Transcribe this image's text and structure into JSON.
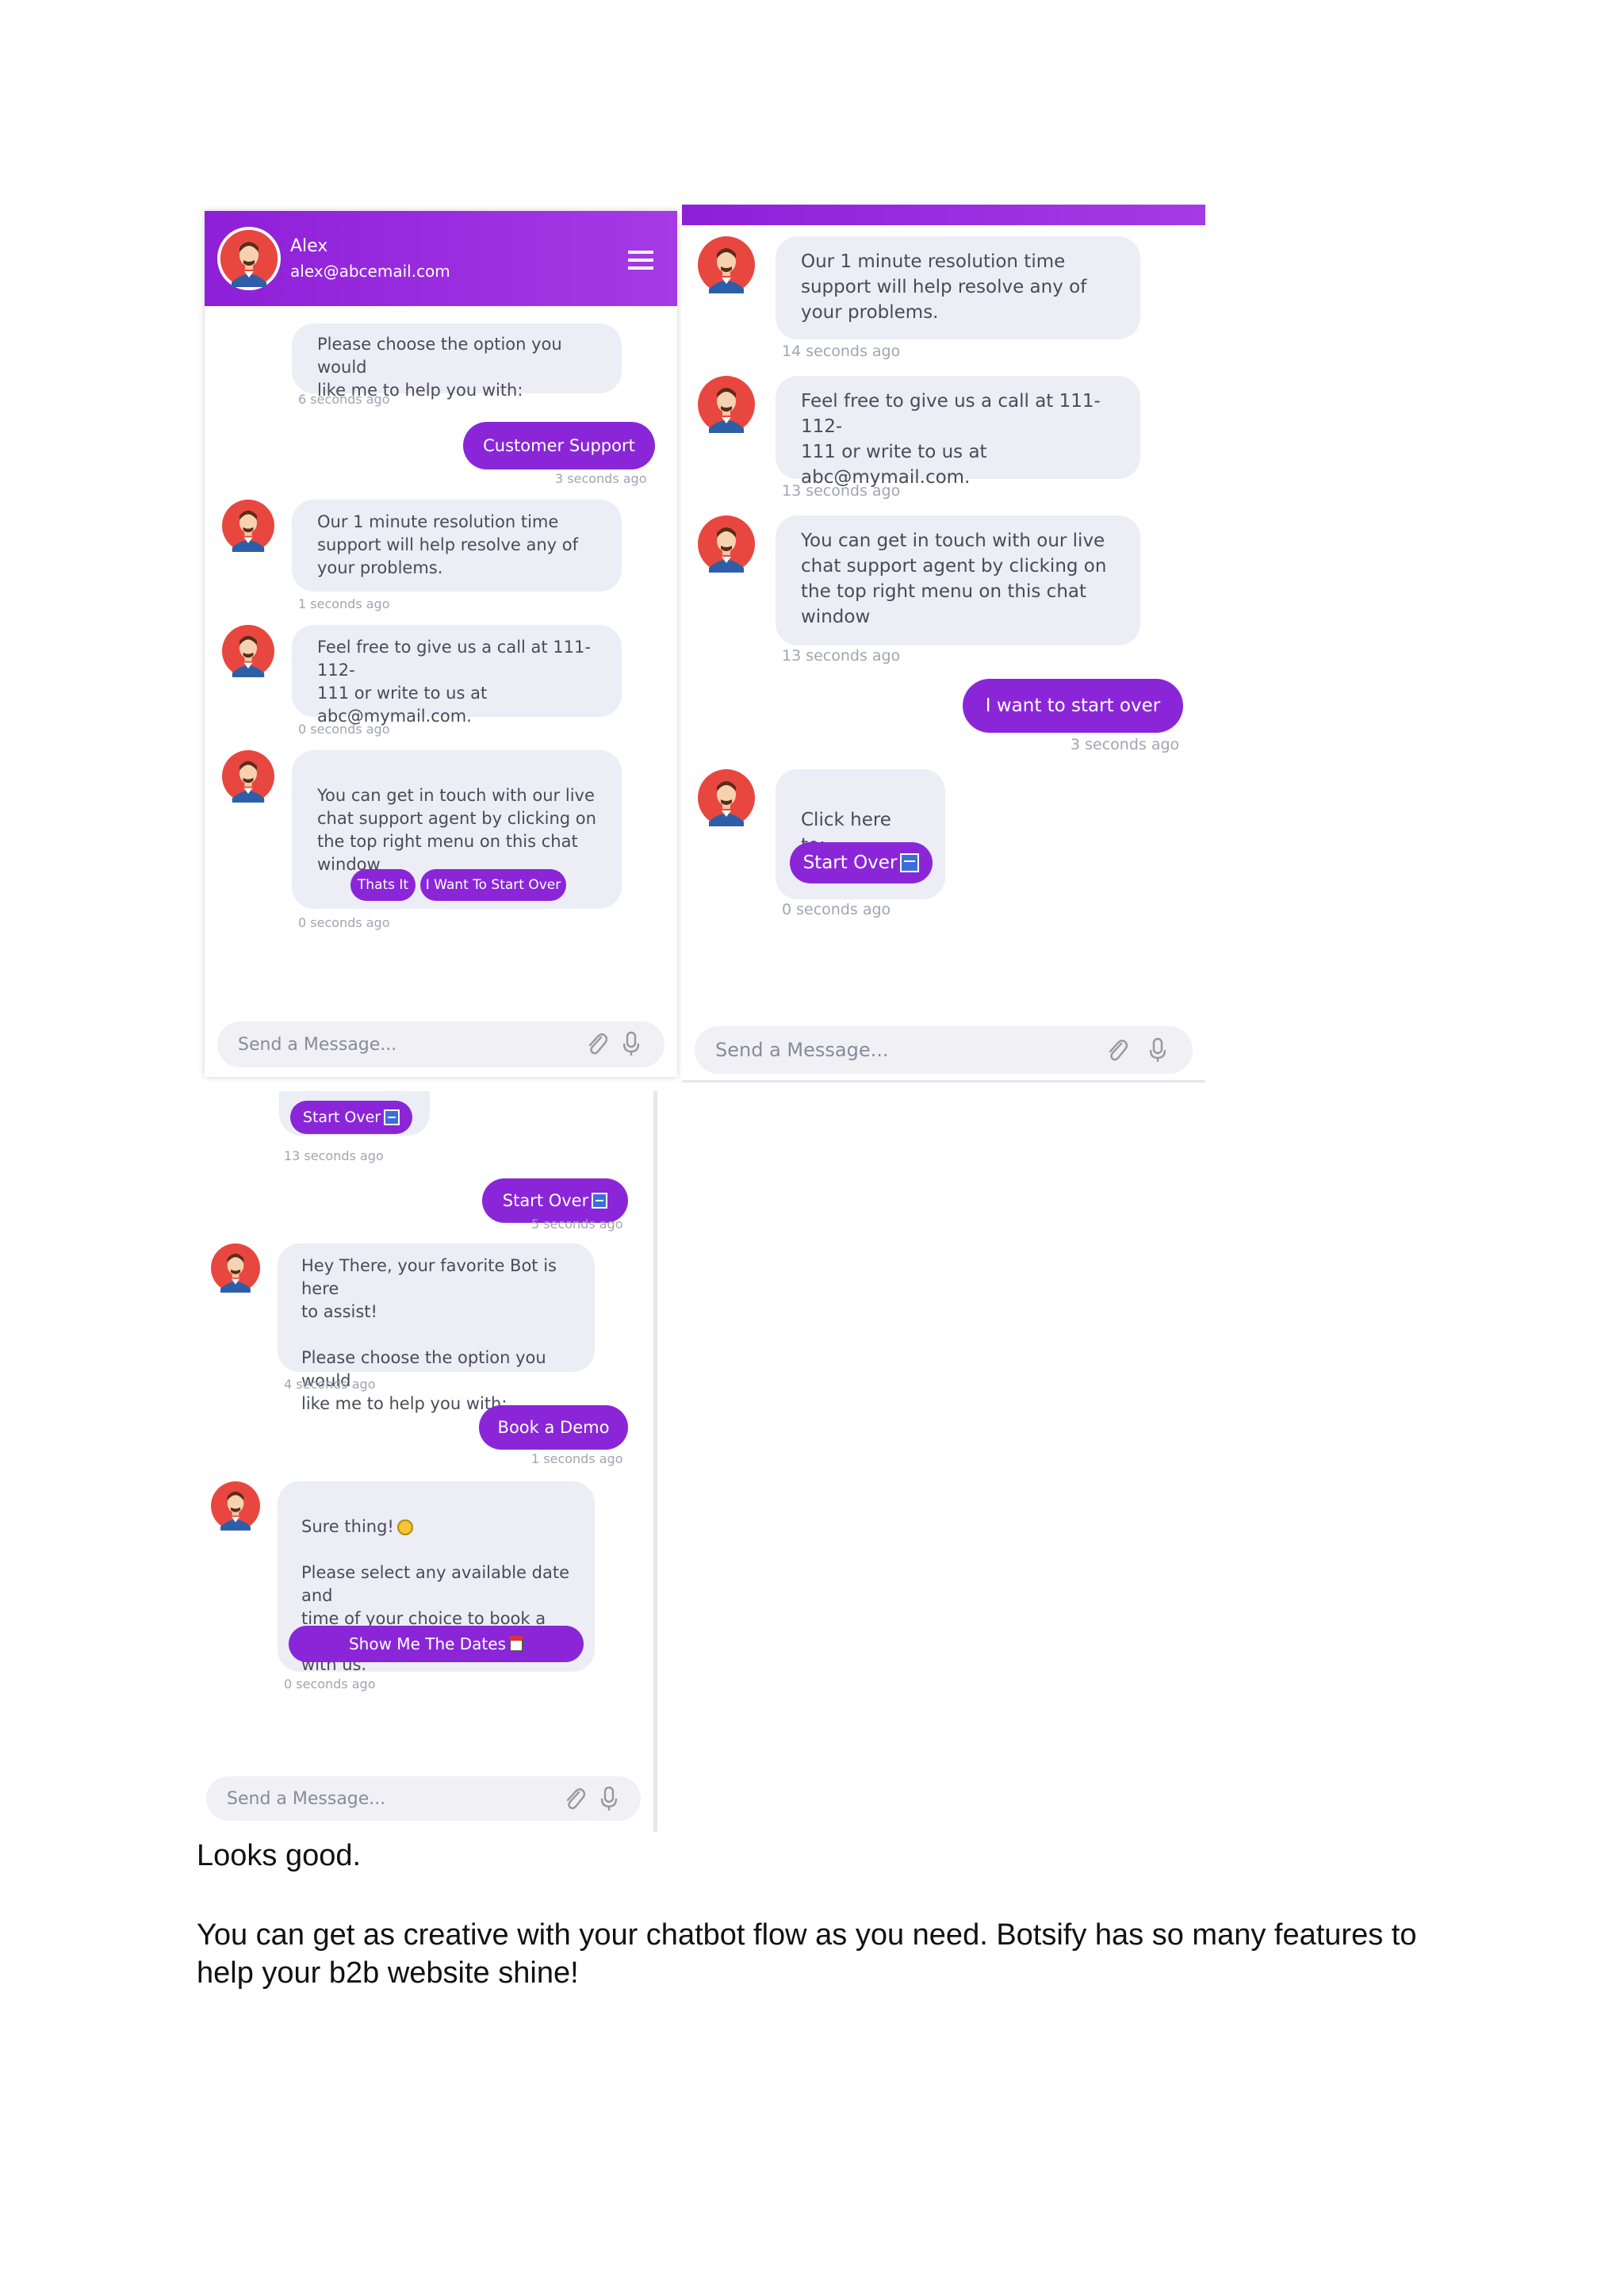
{
  "panel1": {
    "header": {
      "name": "Alex",
      "email": "alex@abcemail.com"
    },
    "bubble_top": "Please choose the option you would\nlike me to help you with:",
    "ts_top": "6 seconds ago",
    "user_reply": "Customer Support",
    "ts_user_reply": "3 seconds ago",
    "bubble_resolution": "Our 1 minute resolution time\nsupport will help resolve any of\nyour problems.",
    "ts_resolution": "1 seconds ago",
    "bubble_call": "Feel free to give us a call at 111-112-\n111 or write to us at\nabc@mymail.com.",
    "ts_call": "0 seconds ago",
    "bubble_live": "You can get in touch with our live\nchat support agent by clicking on\nthe top right menu on this chat\nwindow",
    "btn_thats_it": "Thats It",
    "btn_start_over": "I Want To Start Over",
    "ts_live": "0 seconds ago",
    "input_placeholder": "Send a Message..."
  },
  "panel2": {
    "bubble_resolution": "Our 1 minute resolution time\nsupport will help resolve any of\nyour problems.",
    "ts_resolution": "14 seconds ago",
    "bubble_call": "Feel free to give us a call at 111-112-\n111 or write to us at\nabc@mymail.com.",
    "ts_call": "13 seconds ago",
    "bubble_live": "You can get in touch with our live\nchat support agent by clicking on\nthe top right menu on this chat\nwindow",
    "ts_live": "13 seconds ago",
    "user_reply": "I want to start over",
    "ts_user_reply": "3 seconds ago",
    "bubble_click": "Click here to:",
    "btn_start_over": "Start Over",
    "ts_click": "0 seconds ago",
    "input_placeholder": "Send a Message..."
  },
  "panel3": {
    "btn_start_over_top": "Start Over",
    "ts_top": "13 seconds ago",
    "user_reply_1": "Start Over",
    "ts_user_reply_1": "5 seconds ago",
    "bubble_hey": "Hey There, your favorite Bot is here\nto assist!\n\nPlease choose the option you would\nlike me to help you with:",
    "ts_hey": "4 seconds ago",
    "user_reply_2": "Book a Demo",
    "ts_user_reply_2": "1 seconds ago",
    "bubble_sure_line1": "Sure thing!",
    "bubble_sure_rest": "Please select any available date and\ntime of your choice to book a demo\nwith us.",
    "btn_show_dates": "Show Me The Dates",
    "ts_sure": "0 seconds ago",
    "input_placeholder": "Send a Message..."
  },
  "text": {
    "looks_good": "Looks good.",
    "para": "You can get as creative with your chatbot flow as you need. Botsify has so many features to help your b2b website shine!"
  },
  "colors": {
    "accent": "#8a26d8",
    "bubble": "#ecedf5",
    "header": "#9a2de0"
  },
  "icons": [
    "avatar-icon",
    "menu-icon",
    "attachment-icon",
    "microphone-icon",
    "back-icon",
    "calendar-icon",
    "smile-icon"
  ]
}
